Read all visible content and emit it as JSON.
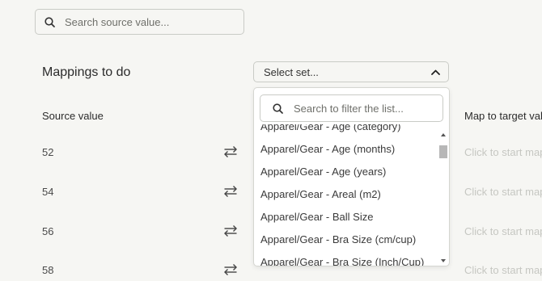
{
  "search": {
    "placeholder": "Search source value..."
  },
  "heading": "Mappings to do",
  "select": {
    "label": "Select set..."
  },
  "columns": {
    "source": "Source value",
    "target": "Map to target value"
  },
  "rows": [
    {
      "value": "52",
      "target": "Click to start mapping"
    },
    {
      "value": "54",
      "target": "Click to start mapping"
    },
    {
      "value": "56",
      "target": "Click to start mapping"
    },
    {
      "value": "58",
      "target": "Click to start mapping"
    }
  ],
  "dropdown": {
    "filter_placeholder": "Search to filter the list...",
    "items": [
      "Apparel/Gear - Age (category)",
      "Apparel/Gear - Age (months)",
      "Apparel/Gear - Age (years)",
      "Apparel/Gear - Areal (m2)",
      "Apparel/Gear - Ball Size",
      "Apparel/Gear - Bra Size (cm/cup)",
      "Apparel/Gear - Bra Size (Inch/Cup)"
    ]
  },
  "icons": {
    "search": "search-icon",
    "chevron": "chevron-up-icon",
    "swap": "swap-arrows-icon"
  },
  "colors": {
    "background": "#f6f6f3",
    "placeholder": "#c6c7c2"
  }
}
